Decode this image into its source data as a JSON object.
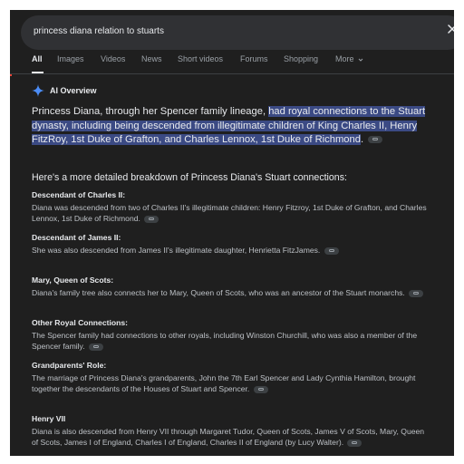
{
  "search": {
    "query": "princess diana relation to stuarts"
  },
  "tabs": [
    {
      "label": "All",
      "active": true
    },
    {
      "label": "Images"
    },
    {
      "label": "Videos"
    },
    {
      "label": "News"
    },
    {
      "label": "Short videos"
    },
    {
      "label": "Forums"
    },
    {
      "label": "Shopping"
    },
    {
      "label": "More"
    }
  ],
  "overview": {
    "title": "AI Overview",
    "intro_plain": "Princess Diana, through her Spencer family lineage, ",
    "intro_highlight": "had royal connections to the Stuart dynasty, including being descended from illegitimate children of King Charles II, Henry FitzRoy, 1st Duke of Grafton, and Charles Lennox, 1st Duke of Richmond",
    "intro_end": ".",
    "breakdown": "Here's a more detailed breakdown of Princess Diana's Stuart connections:",
    "sections": [
      {
        "heading": "Descendant of Charles II:",
        "body": "Diana was descended from two of Charles II's illegitimate children: Henry Fitzroy, 1st Duke of Grafton, and Charles Lennox, 1st Duke of Richmond."
      },
      {
        "heading": "Descendant of James II:",
        "body": "She was also descended from James II's illegitimate daughter, Henrietta FitzJames."
      },
      {
        "heading": "Mary, Queen of Scots:",
        "body": "Diana's family tree also connects her to Mary, Queen of Scots, who was an ancestor of the Stuart monarchs."
      },
      {
        "heading": "Other Royal Connections:",
        "body": "The Spencer family had connections to other royals, including Winston Churchill, who was also a member of the Spencer family."
      },
      {
        "heading": "Grandparents' Role:",
        "body": "The marriage of Princess Diana's grandparents, John the 7th Earl Spencer and Lady Cynthia Hamilton, brought together the descendants of the Houses of Stuart and Spencer."
      },
      {
        "heading": "Henry VII",
        "body": "Diana is also descended from Henry VII through Margaret Tudor, Queen of Scots, James V of Scots, Mary, Queen of Scots, James I of England, Charles I of England, Charles II of England (by Lucy Walter)."
      }
    ]
  },
  "icons": {
    "clear": "close-icon",
    "ai": "sparkle-icon",
    "link": "link-icon",
    "more": "chevron-down-icon"
  },
  "colors": {
    "background": "#1f1f1f",
    "highlight": "#3b4a84",
    "ai_icon": "#4c8df6"
  }
}
